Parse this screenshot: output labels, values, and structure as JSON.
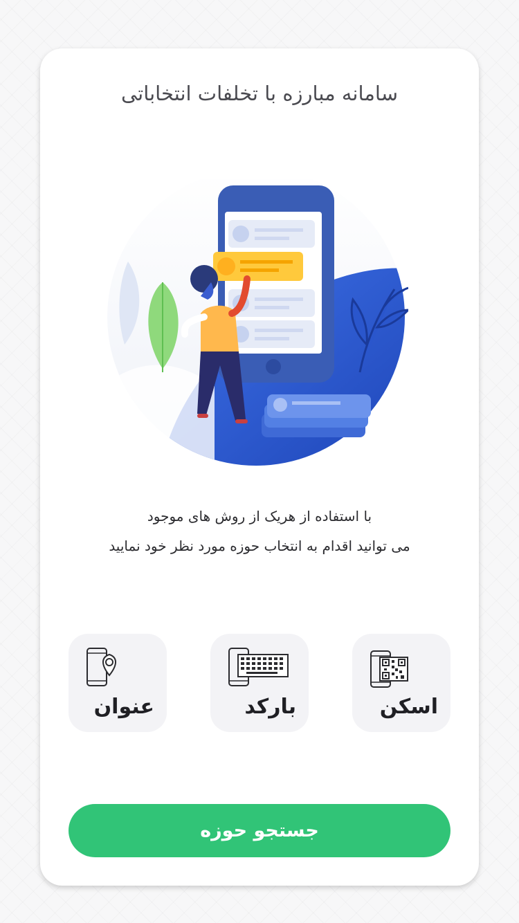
{
  "title": "سامانه مبارزه با تخلفات انتخاباتی",
  "description": {
    "line1": "با استفاده از هریک از روش های موجود",
    "line2": "می توانید اقدام به انتخاب حوزه مورد نظر خود نمایید"
  },
  "options": [
    {
      "label": "اسکن",
      "icon": "qr-scan-icon"
    },
    {
      "label": "بارکد",
      "icon": "barcode-keyboard-icon"
    },
    {
      "label": "عنوان",
      "icon": "location-pin-icon"
    }
  ],
  "search_button": "جستجو حوزه",
  "colors": {
    "accent": "#31c477",
    "card": "#ffffff",
    "option_bg": "#f3f3f6",
    "title_text": "#4a4a50"
  },
  "illustration": "person-selecting-from-phone-list"
}
